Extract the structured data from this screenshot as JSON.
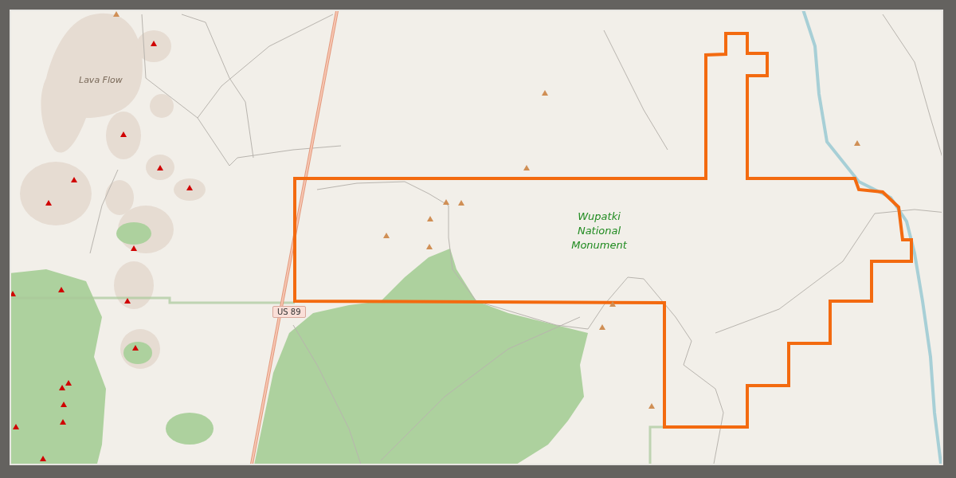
{
  "map": {
    "labels": [
      {
        "kind": "area",
        "text": "Lava Flow"
      },
      {
        "kind": "park",
        "text": "Wupatki National Monument"
      },
      {
        "kind": "road-shield",
        "text": "US 89"
      }
    ]
  }
}
